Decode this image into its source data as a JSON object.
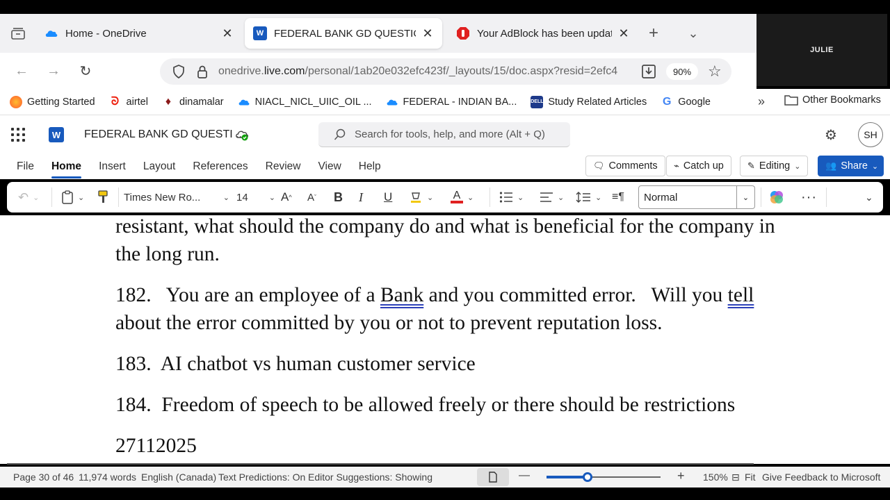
{
  "browser": {
    "tabs": [
      {
        "title": "Home - OneDrive",
        "active": false
      },
      {
        "title": "FEDERAL BANK GD QUESTIONS.docx",
        "active": true
      },
      {
        "title": "Your AdBlock has been updated!",
        "active": false
      }
    ],
    "url_host": "onedrive.",
    "url_domain": "live.com",
    "url_path": "/personal/1ab20e032efc423f/_layouts/15/doc.aspx?resid=2efc4",
    "zoom": "90%",
    "bookmarks": [
      {
        "label": "Getting Started",
        "icon": "firefox-icon"
      },
      {
        "label": "airtel",
        "icon": "airtel-icon"
      },
      {
        "label": "dinamalar",
        "icon": "dinamalar-icon"
      },
      {
        "label": "NIACL_NICL_UIIC_OIL ...",
        "icon": "cloud-icon"
      },
      {
        "label": "FEDERAL - INDIAN BA...",
        "icon": "cloud-icon"
      },
      {
        "label": "Study Related Articles",
        "icon": "dell-icon"
      },
      {
        "label": "Google",
        "icon": "google-icon"
      }
    ],
    "other_bookmarks": "Other Bookmarks"
  },
  "video": {
    "participant": "JULIE"
  },
  "word": {
    "doc_title": "FEDERAL BANK GD QUESTI ...",
    "search_placeholder": "Search for tools, help, and more (Alt + Q)",
    "avatar_initials": "SH",
    "menu": [
      "File",
      "Home",
      "Insert",
      "Layout",
      "References",
      "Review",
      "View",
      "Help"
    ],
    "active_menu": "Home",
    "comments_label": "Comments",
    "catchup_label": "Catch up",
    "editing_label": "Editing",
    "share_label": "Share",
    "font_name": "Times New Ro...",
    "font_size": "14",
    "style": "Normal",
    "accent": "#185abd"
  },
  "document": {
    "lines": [
      "resistant, what should the company do and what is beneficial for the company in",
      "the long run.",
      "about the error committed by you or not to prevent reputation loss.",
      "183.  AI chatbot vs human customer service",
      "184.  Freedom of speech to be allowed freely or there should be restrictions",
      "27112025"
    ],
    "q182_a": "182.   You are an employee of a ",
    "q182_bank": "Bank",
    "q182_b": " and you committed error.   Will you ",
    "q182_tell": "tell"
  },
  "status": {
    "page": "Page 30 of 46",
    "words": "11,974 words",
    "language": "English (Canada)",
    "predictions": "Text Predictions: On",
    "editor": "Editor Suggestions: Showing",
    "zoom": "150%",
    "zoom_fraction": 0.36,
    "fit": "Fit",
    "feedback": "Give Feedback to Microsoft"
  }
}
